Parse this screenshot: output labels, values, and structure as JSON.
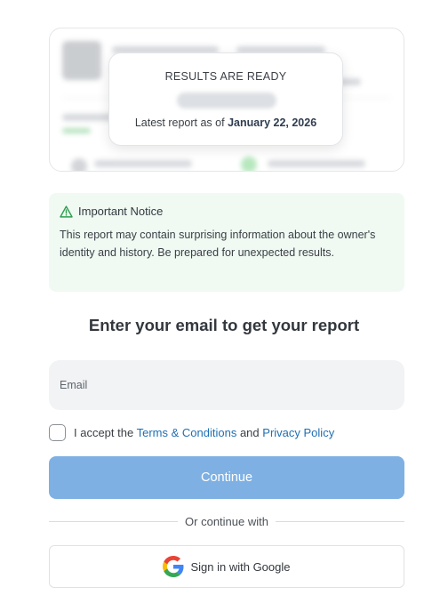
{
  "results": {
    "title": "RESULTS ARE READY",
    "date_prefix": "Latest report as of",
    "date": "January 22, 2026"
  },
  "notice": {
    "title": "Important Notice",
    "body": "This report may contain surprising information about the owner's identity and history. Be prepared for unexpected results.",
    "icon": "warning-triangle-icon"
  },
  "form": {
    "heading": "Enter your email to get your report",
    "email_placeholder": "Email",
    "terms_prefix": "I accept the",
    "terms_link": "Terms & Conditions",
    "terms_and": "and",
    "privacy_link": "Privacy Policy",
    "continue_label": "Continue",
    "divider_text": "Or continue with",
    "google_label": "Sign in with Google"
  },
  "colors": {
    "accent": "#7eb0e3",
    "link": "#1f6fb2",
    "notice_bg": "#f0faf3",
    "notice_icon": "#2e9e4f"
  }
}
